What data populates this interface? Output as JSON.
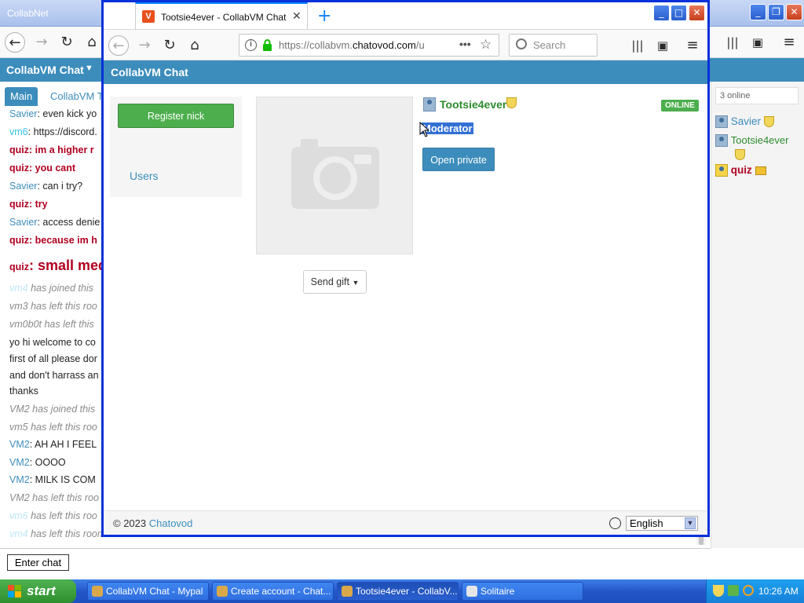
{
  "background_window": {
    "title": "CollabNet",
    "app_title": "CollabVM Chat",
    "chat_tabs": [
      "Main",
      "CollabVM T"
    ],
    "messages": [
      {
        "nick": "Savier",
        "text": ": even kick yo",
        "style": "normal",
        "nick_color": "blue"
      },
      {
        "nick": "vm6",
        "text": ": https://discord.",
        "style": "normal",
        "nick_color": "cyan"
      },
      {
        "nick": "quiz",
        "text": ": im a higher r",
        "style": "bold",
        "nick_color": "red"
      },
      {
        "nick": "quiz",
        "text": ": you cant",
        "style": "bold",
        "nick_color": "red"
      },
      {
        "nick": "Savier",
        "text": ": can i try?",
        "style": "normal",
        "nick_color": "blue"
      },
      {
        "nick": "quiz",
        "text": ": try",
        "style": "bold",
        "nick_color": "red"
      },
      {
        "nick": "Savier",
        "text": ": access denie",
        "style": "normal",
        "nick_color": "blue"
      },
      {
        "nick": "quiz",
        "text": ": because im h",
        "style": "bold",
        "nick_color": "red"
      },
      {
        "nick": "quiz",
        "text": ": small medium",
        "style": "sizes",
        "nick_color": "red"
      },
      {
        "nick": "vm4",
        "text": " has joined this",
        "style": "system",
        "nick_color": "pale"
      },
      {
        "nick": "",
        "text": "vm3 has left this roo",
        "style": "system",
        "nick_color": ""
      },
      {
        "nick": "",
        "text": "vm0b0t has left this",
        "style": "system",
        "nick_color": ""
      },
      {
        "nick": "",
        "text": "yo hi welcome to co",
        "style": "plain",
        "nick_color": ""
      },
      {
        "nick": "",
        "text": "first of all please dor",
        "style": "plain",
        "nick_color": ""
      },
      {
        "nick": "",
        "text": "and don't harrass an",
        "style": "plain",
        "nick_color": ""
      },
      {
        "nick": "",
        "text": "thanks",
        "style": "plain",
        "nick_color": ""
      },
      {
        "nick": "",
        "text": "VM2 has joined this",
        "style": "system",
        "nick_color": ""
      },
      {
        "nick": "",
        "text": "vm5 has left this roo",
        "style": "system",
        "nick_color": ""
      },
      {
        "nick": "VM2",
        "text": ": AH AH I FEEL",
        "style": "normal",
        "nick_color": "blue"
      },
      {
        "nick": "VM2",
        "text": ": OOOO",
        "style": "normal",
        "nick_color": "blue"
      },
      {
        "nick": "VM2",
        "text": ": MILK IS COM",
        "style": "normal",
        "nick_color": "blue"
      },
      {
        "nick": "",
        "text": "VM2 has left this roo",
        "style": "system",
        "nick_color": ""
      },
      {
        "nick": "vm6",
        "text": " has left this roo",
        "style": "system",
        "nick_color": "pale"
      },
      {
        "nick": "vm4",
        "text": " has left this room",
        "style": "system",
        "nick_color": "pale"
      }
    ],
    "online": {
      "count": "3 online",
      "users": [
        {
          "name": "Savier",
          "color": "#3c8dbc",
          "badge": "shield"
        },
        {
          "name": "Tootsie4ever",
          "color": "#2e8b2e",
          "badge": "shield"
        },
        {
          "name": "quiz",
          "color": "#b00020",
          "badge": "crown"
        }
      ]
    },
    "enter_chat_label": "Enter chat"
  },
  "popup": {
    "tab_title": "Tootsie4ever - CollabVM Chat",
    "url_prefix": "https://collabvm.",
    "url_domain": "chatovod.com",
    "url_suffix": "/u",
    "search_placeholder": "Search",
    "app_title": "CollabVM Chat",
    "register_label": "Register nick",
    "users_link": "Users",
    "send_gift_label": "Send gift",
    "profile": {
      "name": "Tootsie4ever",
      "status": "ONLINE",
      "role": "Moderator",
      "open_private_label": "Open private"
    },
    "footer": {
      "copyright": "© 2023 ",
      "brand": "Chatovod",
      "language": "English"
    }
  },
  "taskbar": {
    "start_label": "start",
    "buttons": [
      {
        "label": "CollabVM Chat - Mypal",
        "active": false
      },
      {
        "label": "Create account - Chat...",
        "active": false
      },
      {
        "label": "Tootsie4ever - CollabV...",
        "active": true
      },
      {
        "label": "Solitaire",
        "active": false
      }
    ],
    "clock": "10:26 AM"
  },
  "colors": {
    "accent": "#3c8dbc",
    "green": "#4cae4c",
    "popup_border": "#0831d9"
  }
}
